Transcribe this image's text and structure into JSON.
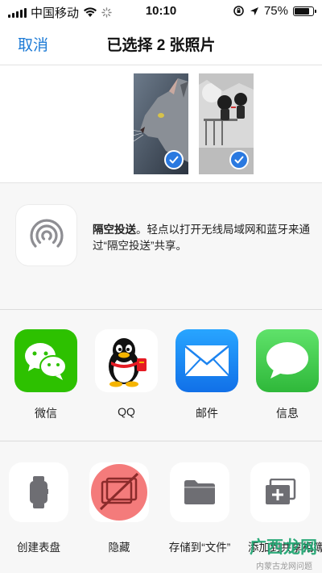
{
  "status_bar": {
    "carrier": "中国移动",
    "time": "10:10",
    "battery_text": "75%",
    "battery_level": 0.75
  },
  "nav": {
    "cancel_label": "取消",
    "title": "已选择 2 张照片"
  },
  "photos": [
    {
      "subject": "cat",
      "selected": true
    },
    {
      "subject": "cartoon-couple",
      "selected": true
    }
  ],
  "airdrop": {
    "title": "隔空投送",
    "description": "。轻点以打开无线局域网和蓝牙来通过“隔空投送”共享。"
  },
  "apps": [
    {
      "label": "微信",
      "icon": "wechat-icon",
      "color": "#2dc100"
    },
    {
      "label": "QQ",
      "icon": "qq-penguin-icon",
      "color": "#ffffff"
    },
    {
      "label": "邮件",
      "icon": "mail-icon",
      "color": "#1e8ef6"
    },
    {
      "label": "信息",
      "icon": "messages-icon",
      "color": "#3fcb4d"
    }
  ],
  "actions": [
    {
      "label": "创建表盘",
      "icon": "watch-icon"
    },
    {
      "label": "隐藏",
      "icon": "hide-icon",
      "color": "#f47b7b"
    },
    {
      "label": "存储到“文件”",
      "icon": "folder-icon"
    },
    {
      "label": "添加到共享相簿",
      "icon": "shared-album-icon"
    }
  ],
  "watermark": {
    "text": "广西龙网",
    "sub": "内蒙古龙网问题"
  },
  "colors": {
    "accent": "#1d7bd6",
    "check": "#2a79e0",
    "section_bg": "#f7f7f7"
  }
}
